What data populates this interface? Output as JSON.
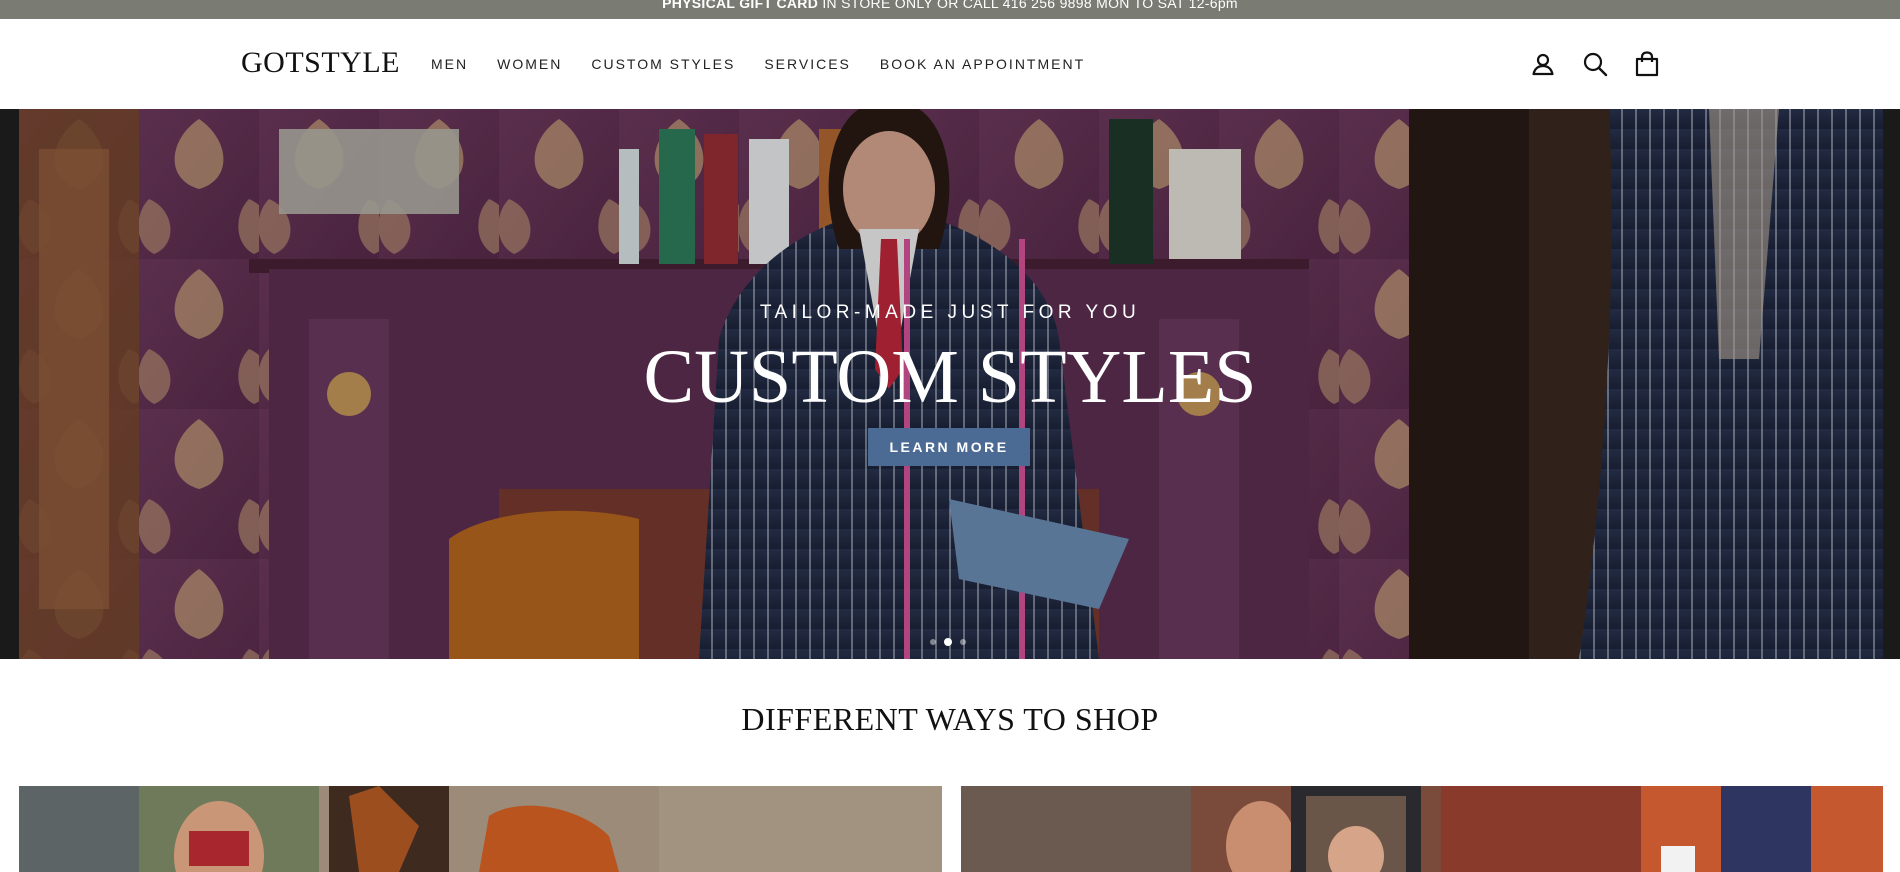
{
  "announcement": {
    "bold": "PHYSICAL GIFT CARD",
    "rest": " IN STORE ONLY OR CALL 416 256 9898 MON TO SAT 12-6pm"
  },
  "header": {
    "logo": "GOTSTYLE",
    "nav": [
      "MEN",
      "WOMEN",
      "CUSTOM STYLES",
      "SERVICES",
      "BOOK AN APPOINTMENT"
    ],
    "icons": [
      "account-icon",
      "search-icon",
      "cart-icon"
    ]
  },
  "hero": {
    "kicker": "TAILOR-MADE JUST FOR YOU",
    "title": "CUSTOM STYLES",
    "button": "LEARN MORE",
    "button_color": "#4c6b94",
    "slides": 3,
    "active_slide": 2
  },
  "shop": {
    "title": "DIFFERENT WAYS TO SHOP"
  },
  "colors": {
    "announcement_bg": "#7a7b73",
    "accent": "#4c6b94"
  }
}
